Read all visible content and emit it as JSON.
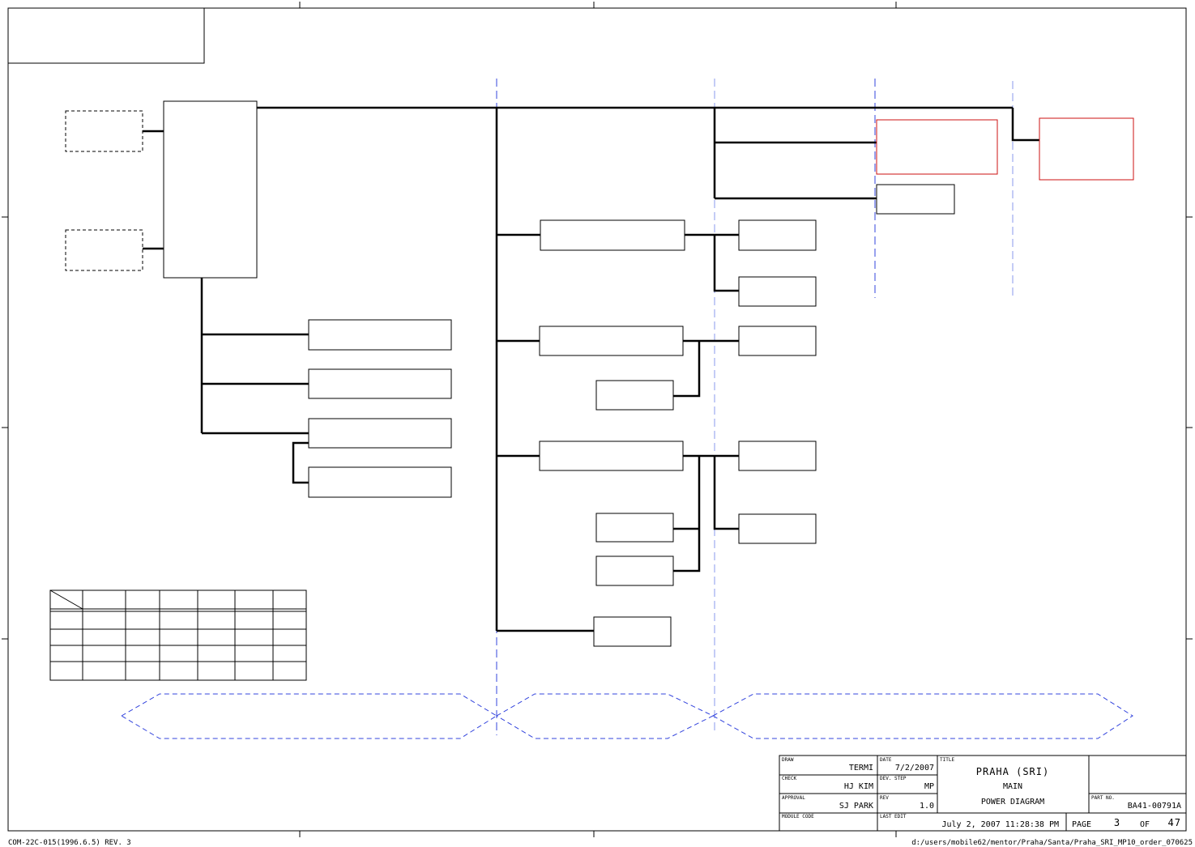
{
  "title_block": {
    "draw_label": "DRAW",
    "draw_value": "TERMI",
    "check_label": "CHECK",
    "check_value": "HJ KIM",
    "approval_label": "APPROVAL",
    "approval_value": "SJ PARK",
    "module_code_label": "MODULE CODE",
    "date_label": "DATE",
    "date_value": "7/2/2007",
    "dev_step_label": "DEV. STEP",
    "dev_step_value": "MP",
    "rev_label": "REV",
    "rev_value": "1.0",
    "last_edit_label": "LAST EDIT",
    "last_edit_value": "July 2, 2007  11:28:38 PM",
    "title_label": "TITLE",
    "title_line1": "PRAHA (SRI)",
    "title_line2": "MAIN",
    "title_line3": "POWER DIAGRAM",
    "part_no_label": "PART NO.",
    "part_no_value": "BA41-00791A",
    "page_label": "PAGE",
    "page_value": "3",
    "of_label": "OF",
    "total_pages": "47"
  },
  "footer": {
    "form_code": "COM-22C-015(1996.6.5) REV. 3",
    "file_path": "d:/users/mobile62/mentor/Praha/Santa/Praha_SRI_MP10_order_070625"
  },
  "colors": {
    "line": "#000000",
    "dashed_blue": "#3344dd",
    "dashed_light_blue": "#8899ee",
    "highlight_red": "#cc1111"
  }
}
